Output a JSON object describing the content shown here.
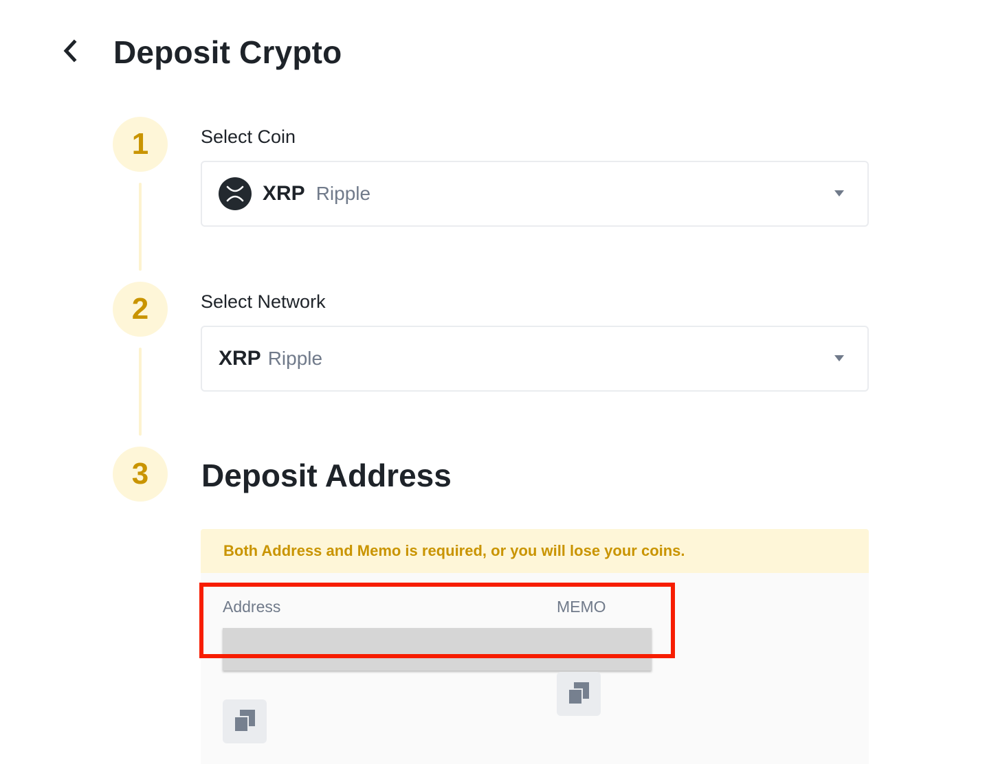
{
  "header": {
    "back_icon": "chevron-left-icon",
    "title": "Deposit Crypto"
  },
  "steps": [
    {
      "number": "1",
      "label": "Select Coin"
    },
    {
      "number": "2",
      "label": "Select Network"
    },
    {
      "number": "3",
      "label": "Deposit Address"
    }
  ],
  "coin_select": {
    "logo_icon": "xrp-logo-icon",
    "symbol": "XRP",
    "name": "Ripple",
    "caret_icon": "caret-down-icon"
  },
  "network_select": {
    "symbol": "XRP",
    "name": "Ripple",
    "caret_icon": "caret-down-icon"
  },
  "deposit": {
    "warning": "Both Address and Memo is required, or you will lose your coins.",
    "address_label": "Address",
    "memo_label": "MEMO",
    "copy_icon": "copy-icon"
  },
  "colors": {
    "accent": "#c99400",
    "accent_bg": "#fef6d8",
    "highlight": "#f71d00",
    "text": "#1e2329",
    "muted": "#707a8a"
  }
}
